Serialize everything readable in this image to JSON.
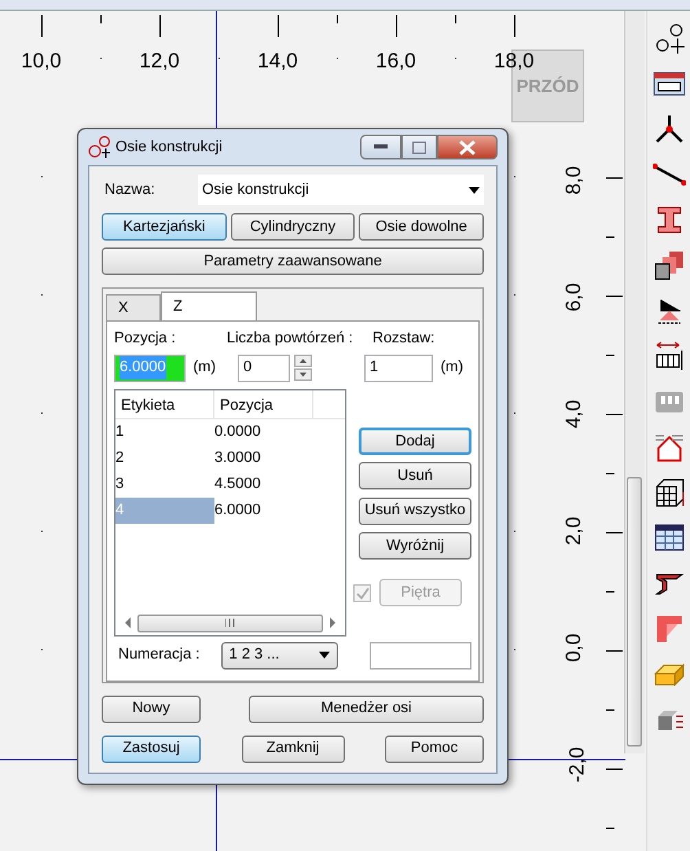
{
  "ruler_top": {
    "labels": [
      "10,0",
      "12,0",
      "14,0",
      "16,0",
      "18,0"
    ]
  },
  "ruler_right": {
    "labels": [
      "8,0",
      "6,0",
      "4,0",
      "2,0",
      "0,0",
      "-2,0"
    ]
  },
  "view_label": "PRZÓD",
  "dialog": {
    "title": "Osie konstrukcji",
    "name_label": "Nazwa:",
    "name_value": "Osie konstrukcji",
    "modes": [
      {
        "label": "Kartezjański",
        "selected": true
      },
      {
        "label": "Cylindryczny",
        "selected": false
      },
      {
        "label": "Osie dowolne",
        "selected": false
      }
    ],
    "advanced_button": "Parametry zaawansowane",
    "tabs": [
      {
        "label": "X",
        "selected": false
      },
      {
        "label": "Z",
        "selected": true
      }
    ],
    "position": {
      "label": "Pozycja :",
      "value": "6.0000",
      "unit": "(m)"
    },
    "repeat": {
      "label": "Liczba powtórzeń :",
      "value": "0"
    },
    "spacing": {
      "label": "Rozstaw:",
      "value": "1",
      "unit": "(m)"
    },
    "table": {
      "columns": [
        "Etykieta",
        "Pozycja"
      ],
      "rows": [
        {
          "cells": [
            "1",
            "0.0000"
          ],
          "selected": false
        },
        {
          "cells": [
            "2",
            "3.0000"
          ],
          "selected": false
        },
        {
          "cells": [
            "3",
            "4.5000"
          ],
          "selected": false
        },
        {
          "cells": [
            "4",
            "6.0000"
          ],
          "selected": true
        }
      ]
    },
    "side_buttons": [
      {
        "label": "Dodaj",
        "default": true
      },
      {
        "label": "Usuń",
        "default": false
      },
      {
        "label": "Usuń wszystko",
        "default": false
      },
      {
        "label": "Wyróżnij",
        "default": false
      }
    ],
    "storeys": {
      "checked": true,
      "disabled": true,
      "label": "Piętra"
    },
    "numbering": {
      "label": "Numeracja :",
      "value": "1 2 3 ..."
    },
    "buttons_row1": [
      {
        "label": "Nowy",
        "highlighted": false
      },
      {
        "label": "Menedżer osi",
        "highlighted": false
      }
    ],
    "buttons_row2": [
      {
        "label": "Zastosuj",
        "highlighted": true
      },
      {
        "label": "Zamknij",
        "highlighted": false
      },
      {
        "label": "Pomoc",
        "highlighted": false
      }
    ]
  }
}
